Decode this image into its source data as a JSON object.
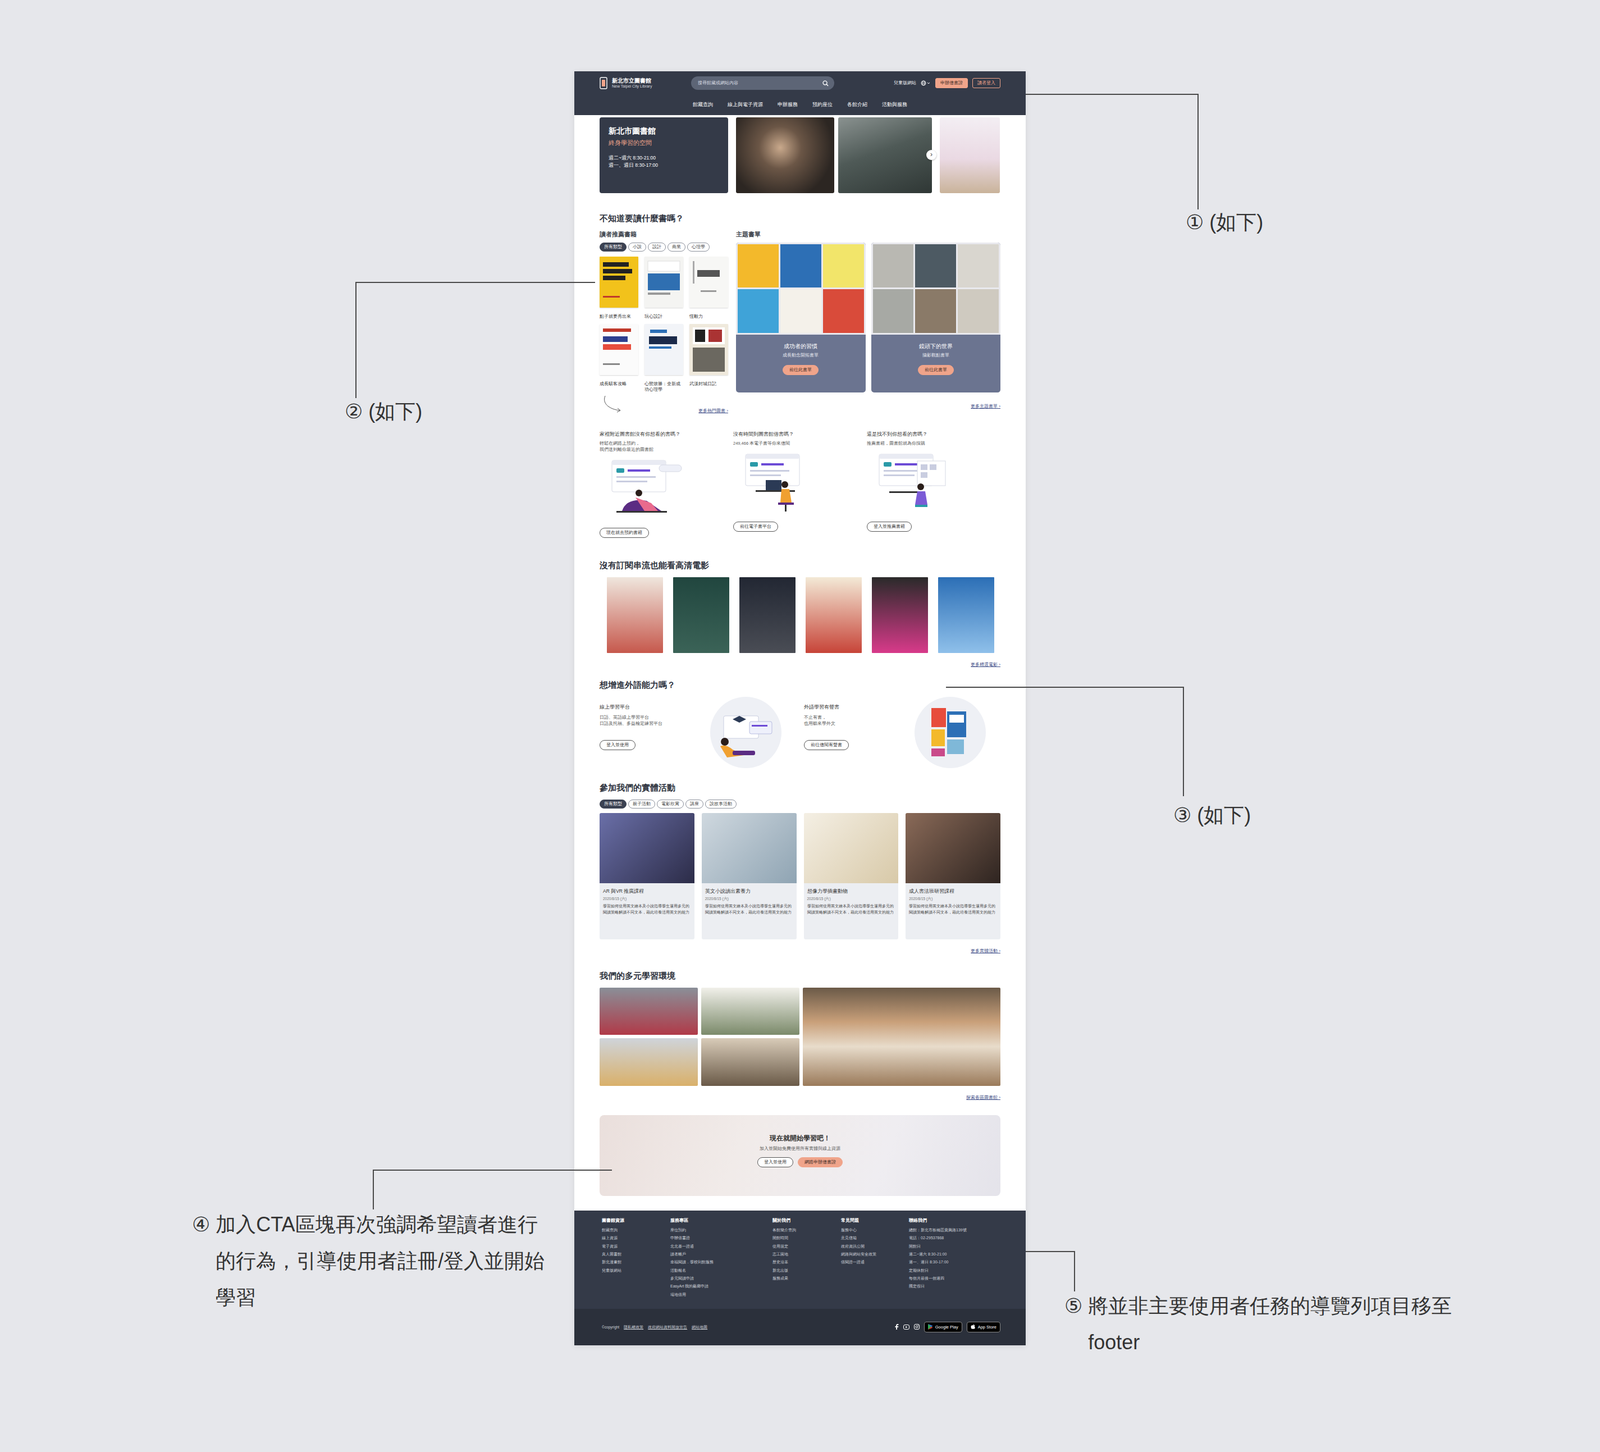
{
  "annotations": [
    {
      "mark": "①",
      "text": "(如下)"
    },
    {
      "mark": "②",
      "text": "(如下)"
    },
    {
      "mark": "③",
      "text": "(如下)"
    },
    {
      "mark": "④",
      "text": "加入CTA區塊再次強調希望讀者進行的行為，引導使用者註冊/登入並開始學習"
    },
    {
      "mark": "⑤",
      "text": "將並非主要使用者任務的導覽列項目移至footer"
    }
  ],
  "header": {
    "title": "新北市立圖書館",
    "subtitle": "New Taipei City Library",
    "search_placeholder": "搜尋館藏或網站內容",
    "kids_link": "兒童版網站",
    "apply": "申辦借書證",
    "login": "讀者登入",
    "nav": [
      "館藏查詢",
      "線上與電子資源",
      "申辦服務",
      "預約座位",
      "各館介紹",
      "活動與服務"
    ]
  },
  "hero": {
    "title": "新北市圖書館",
    "subtitle": "終身學習的空間",
    "hours": [
      "週二~週六 8:30-21:00",
      "週一、週日 8:30-17:00"
    ],
    "next": "›"
  },
  "books": {
    "title": "不知道要讀什麼書嗎？",
    "recommend": {
      "heading": "讀者推薦書籍",
      "tags": [
        {
          "label": "所有類型",
          "selected": true
        },
        {
          "label": "小說",
          "selected": false
        },
        {
          "label": "設計",
          "selected": false
        },
        {
          "label": "商業",
          "selected": false
        },
        {
          "label": "心理學",
          "selected": false
        }
      ],
      "items": [
        {
          "title": "點子就要秀出來"
        },
        {
          "title": "玩心設計"
        },
        {
          "title": "恆毅力"
        },
        {
          "title": "成長駭客攻略"
        },
        {
          "title": "心態致勝：全新成功心理學"
        },
        {
          "title": "武漢封城日記"
        }
      ],
      "more": "更多熱門圖書 ›"
    },
    "lists": {
      "heading": "主題書單",
      "cards": [
        {
          "name": "成功者的習慣",
          "desc": "成長動念開拓書單",
          "button": "前往此書單"
        },
        {
          "name": "鏡頭下的世界",
          "desc": "攝影觀點書單",
          "button": "前往此書單"
        }
      ],
      "more": "更多主題書單 ›"
    }
  },
  "promos": [
    {
      "title": "家裡附近圖書館沒有你想看的書嗎？",
      "lines": [
        "輕鬆在網路上預約，",
        "我們送到離你最近的圖書館"
      ],
      "button": "現在就去預約書籍"
    },
    {
      "title": "沒有時間到圖書館借書嗎？",
      "lines": [
        "249,466 本電子書等你來借閱"
      ],
      "button": "前往電子書平台"
    },
    {
      "title": "還是找不到你想看的書嗎？",
      "lines": [
        "推薦書籍，圖書館就為你採購"
      ],
      "button": "登入並推薦書籍"
    }
  ],
  "movies": {
    "title": "沒有訂閱串流也能看高清電影",
    "more": "更多精選電影 ›"
  },
  "languages": {
    "title": "想增進外語能力嗎？",
    "items": [
      {
        "name": "線上學習平台",
        "lines": [
          "日語、英語線上學習平台",
          "日語及托福、多益檢定練習平台"
        ],
        "button": "登入並使用"
      },
      {
        "name": "外語學習有聲書",
        "lines": [
          "不止有書，",
          "也用聽來學外文"
        ],
        "button": "前往借閱有聲書"
      }
    ]
  },
  "events": {
    "title": "參加我們的實體活動",
    "tags": [
      {
        "label": "所有類型",
        "selected": true
      },
      {
        "label": "親子活動",
        "selected": false
      },
      {
        "label": "電影欣賞",
        "selected": false
      },
      {
        "label": "講座",
        "selected": false
      },
      {
        "label": "說故事活動",
        "selected": false
      }
    ],
    "cards": [
      {
        "title": "AR 與VR 推廣課程",
        "date": "2020/8/15 (六)",
        "desc": "學習如何使用英文繪本及小說指導學生運用多元的閱讀策略解讀不同文本，藉此培養活用英文的能力"
      },
      {
        "title": "英文小說讀出素養力",
        "date": "2020/8/15 (六)",
        "desc": "學習如何使用英文繪本及小說指導學生運用多元的閱讀策略解讀不同文本，藉此培養活用英文的能力"
      },
      {
        "title": "想像力學插畫動物",
        "date": "2020/8/15 (六)",
        "desc": "學習如何使用英文繪本及小說指導學生運用多元的閱讀策略解讀不同文本，藉此培養活用英文的能力"
      },
      {
        "title": "成人書法班研習課程",
        "date": "2020/8/15 (六)",
        "desc": "學習如何使用英文繪本及小說指導學生運用多元的閱讀策略解讀不同文本，藉此培養活用英文的能力"
      }
    ],
    "more": "更多實體活動 ›"
  },
  "spaces": {
    "title": "我們的多元學習環境",
    "more": "探索各區圖書館 ›"
  },
  "cta": {
    "title": "現在就開始學習吧！",
    "sub": "加入並開始免費使用所有實體與線上資源",
    "buttons": [
      {
        "label": "登入並使用",
        "kind": "outline"
      },
      {
        "label": "網路申辦借書證",
        "kind": "primary"
      }
    ]
  },
  "footer": {
    "columns": [
      {
        "heading": "圖書館資源",
        "links": [
          "館藏查詢",
          "線上資源",
          "電子資源",
          "真人圖書館",
          "新北漫畫館",
          "兒童版網站"
        ]
      },
      {
        "heading": "服務專區",
        "links": [
          "座位預約",
          "申辦借書證",
          "北北基一證通",
          "讀者帳戶",
          "幸福閱讀．學校到館服務",
          "活動報名",
          "多元閱讀申請",
          "EasyArt 我的藝廊申請",
          "場地借用"
        ]
      },
      {
        "heading": "關於我們",
        "links": [
          "各館簡介查詢",
          "開館時間",
          "使用規定",
          "志工園地",
          "歷史沿革",
          "新北出版",
          "服務成果"
        ]
      },
      {
        "heading": "常見問題",
        "links": [
          "服務中心",
          "意見信箱",
          "政府資訊公開",
          "網路與網站安全政策",
          "借閱證一證通"
        ]
      },
      {
        "heading": "聯絡我們",
        "links": [
          "總館：新北市板橋區貴興路139號",
          "電話：02-29537868",
          "開館日",
          "週二~週六 8:30-21:00",
          "週一、週日 8:30-17:00",
          "定期休館日",
          "每個月最後一個週四",
          "國定假日"
        ]
      }
    ],
    "copyright": "©copyright",
    "legal": [
      "隱私權政策",
      "政府網站資料開放宣告",
      "網站地圖"
    ],
    "stores": [
      "Google Play",
      "App Store"
    ]
  }
}
